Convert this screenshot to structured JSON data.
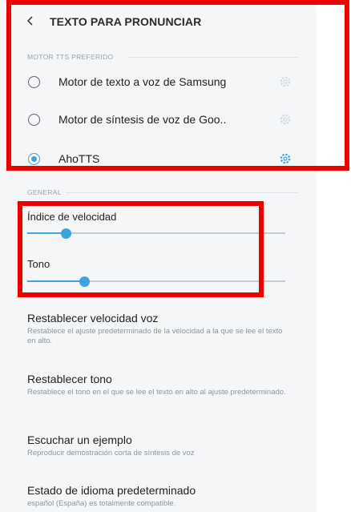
{
  "header": {
    "title": "TEXTO PARA PRONUNCIAR"
  },
  "tts_section": {
    "heading": "MOTOR TTS PREFERIDO",
    "engines": [
      {
        "label": "Motor de texto a voz de Samsung",
        "selected": false,
        "icon": "gear-icon"
      },
      {
        "label": "Motor de síntesis de voz de Goo..",
        "selected": false,
        "icon": "gear-icon"
      },
      {
        "label": "AhoTTS",
        "selected": true,
        "icon": "gear-icon"
      }
    ]
  },
  "general_section": {
    "heading": "GENERAL",
    "speech_rate": {
      "label": "Índice de velocidad",
      "value_fraction": 0.15
    },
    "pitch": {
      "label": "Tono",
      "value_fraction": 0.22
    }
  },
  "items": [
    {
      "title": "Restablecer velocidad voz",
      "subtitle": "Restablece el ajuste predeterminado de la velocidad a la que se lee el texto en alto."
    },
    {
      "title": "Restablecer tono",
      "subtitle": "Restablece el tono en el que se lee el texto en alto al ajuste predeterminado."
    },
    {
      "title": "Escuchar un ejemplo",
      "subtitle": "Reproducir demostración corta de síntesis de voz"
    },
    {
      "title": "Estado de idioma predeterminado",
      "subtitle": "español (España) es totalmente compatible."
    }
  ],
  "colors": {
    "accent": "#3ea3e0",
    "highlight": "#ee0000",
    "background": "#f5f6f8"
  }
}
